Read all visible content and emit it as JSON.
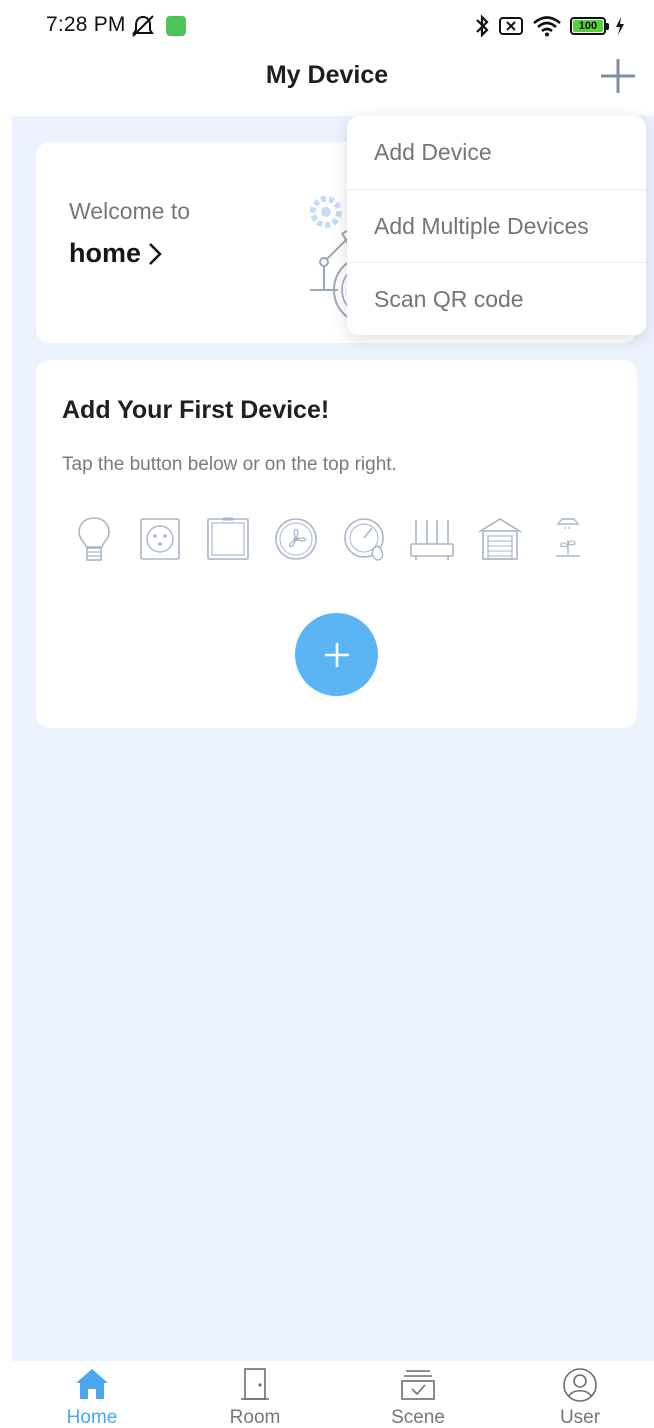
{
  "status_bar": {
    "time": "7:28 PM",
    "battery_level": "100",
    "colors": {
      "app_icon": "#4cc65a",
      "battery_fill": "#5ad03c"
    },
    "icons": [
      "mute-icon",
      "app-notification-icon",
      "bluetooth-icon",
      "sim-off-icon",
      "wifi-icon",
      "battery-icon",
      "charging-icon"
    ]
  },
  "header": {
    "title": "My Device",
    "add_icon": "plus-icon"
  },
  "welcome": {
    "line1": "Welcome to",
    "home_name": "home",
    "chevron_icon": "chevron-right-icon",
    "illustration": "gear-robot-arm-illustration"
  },
  "first_device": {
    "title": "Add Your First Device!",
    "subtitle": "Tap the button below or on the top right.",
    "device_icons": [
      "bulb-icon",
      "socket-icon",
      "switch-icon",
      "fan-icon",
      "gauge-icon",
      "router-icon",
      "garage-icon",
      "plant-lamp-icon"
    ],
    "add_button_icon": "plus-icon"
  },
  "menu": {
    "items": [
      {
        "label": "Add Device"
      },
      {
        "label": "Add Multiple Devices"
      },
      {
        "label": "Scan QR code"
      }
    ]
  },
  "tabbar": {
    "tabs": [
      {
        "label": "Home",
        "icon": "home-icon",
        "active": true
      },
      {
        "label": "Room",
        "icon": "door-icon",
        "active": false
      },
      {
        "label": "Scene",
        "icon": "scene-icon",
        "active": false
      },
      {
        "label": "User",
        "icon": "user-icon",
        "active": false
      }
    ]
  },
  "colors": {
    "accent": "#5bb5f5",
    "background": "#ecf3fe",
    "tab_active": "#4aa7ec"
  }
}
